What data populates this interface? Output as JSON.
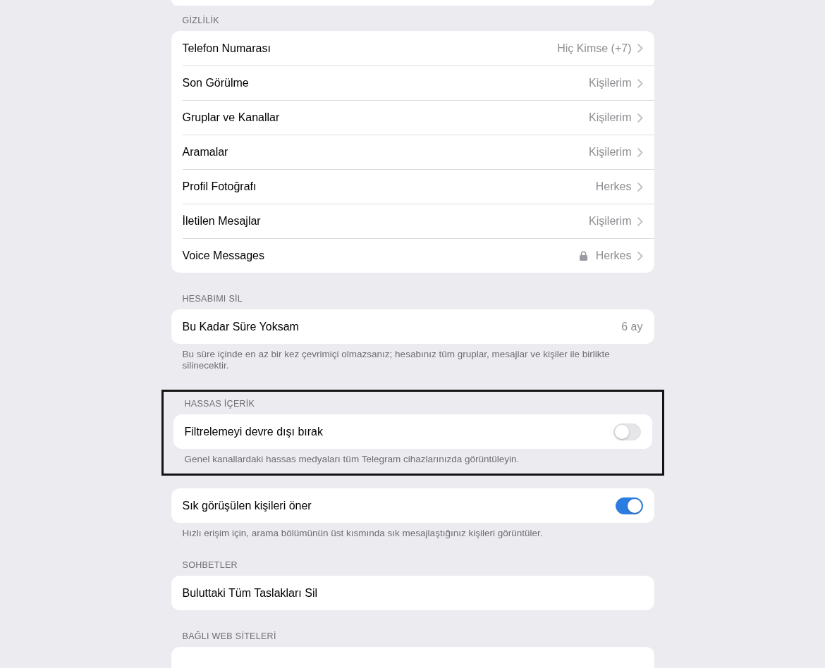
{
  "sections": [
    {
      "header": "GİZLİLİK",
      "highlighted": false,
      "rows": [
        {
          "label": "Telefon Numarası",
          "kind": "link",
          "value": "Hiç Kimse (+7)",
          "locked": false
        },
        {
          "label": "Son Görülme",
          "kind": "link",
          "value": "Kişilerim",
          "locked": false
        },
        {
          "label": "Gruplar ve Kanallar",
          "kind": "link",
          "value": "Kişilerim",
          "locked": false
        },
        {
          "label": "Aramalar",
          "kind": "link",
          "value": "Kişilerim",
          "locked": false
        },
        {
          "label": "Profil Fotoğrafı",
          "kind": "link",
          "value": "Herkes",
          "locked": false
        },
        {
          "label": "İletilen Mesajlar",
          "kind": "link",
          "value": "Kişilerim",
          "locked": false
        },
        {
          "label": "Voice Messages",
          "kind": "link",
          "value": "Herkes",
          "locked": true
        }
      ]
    },
    {
      "header": "HESABIMI SİL",
      "highlighted": false,
      "rows": [
        {
          "label": "Bu Kadar Süre Yoksam",
          "kind": "value",
          "value": "6 ay"
        }
      ],
      "footer": "Bu süre içinde en az bir kez çevrimiçi olmazsanız; hesabınız tüm gruplar, mesajlar ve kişiler ile birlikte silinecektir."
    },
    {
      "header": "HASSAS İÇERİK",
      "highlighted": true,
      "rows": [
        {
          "label": "Filtrelemeyi devre dışı bırak",
          "kind": "toggle",
          "on": false
        }
      ],
      "footer": "Genel kanallardaki hassas medyaları tüm Telegram cihazlarınızda görüntüleyin."
    },
    {
      "highlighted": false,
      "rows": [
        {
          "label": "Sık görüşülen kişileri öner",
          "kind": "toggle",
          "on": true
        }
      ],
      "footer": "Hızlı erişim için, arama bölümünün üst kısmında sık mesajlaştığınız kişileri görüntüler."
    },
    {
      "header": "SOHBETLER",
      "highlighted": false,
      "rows": [
        {
          "label": "Buluttaki Tüm Taslakları Sil",
          "kind": "action"
        }
      ]
    },
    {
      "header": "BAĞLI WEB SİTELERİ",
      "highlighted": false
    }
  ]
}
